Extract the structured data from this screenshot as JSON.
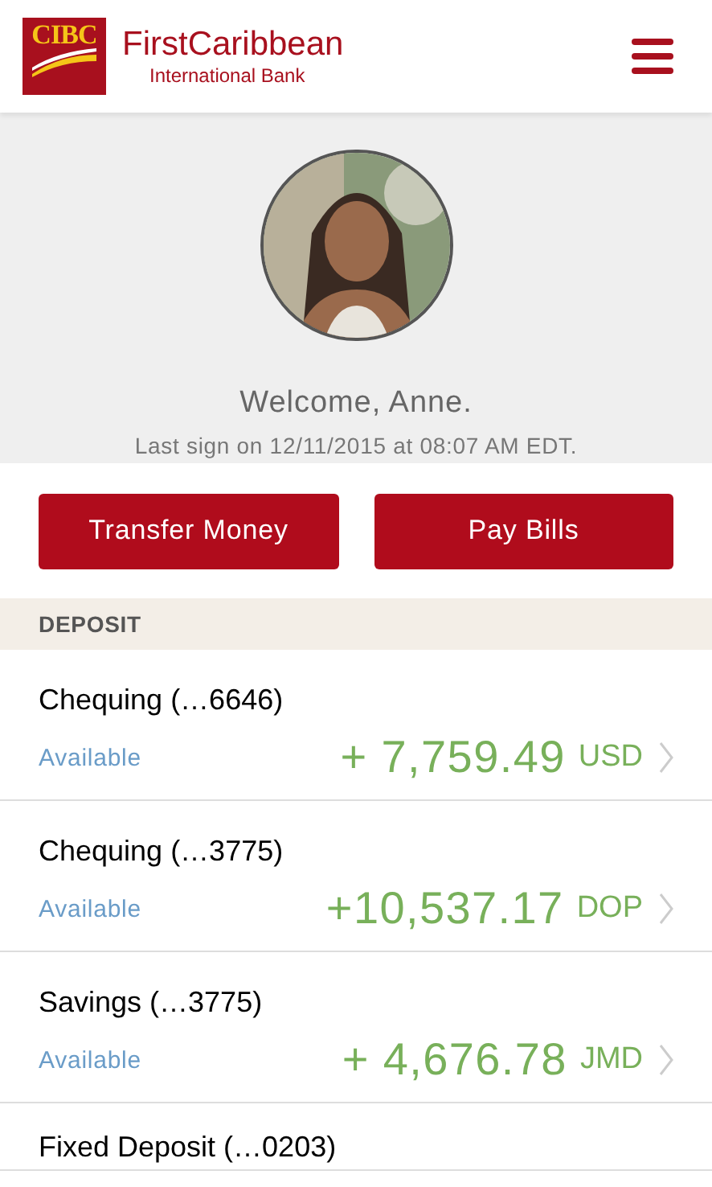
{
  "header": {
    "logo_mark": "CIBC",
    "brand": "FirstCaribbean",
    "brand_sub": "International Bank"
  },
  "profile": {
    "welcome": "Welcome, Anne.",
    "last_sign": "Last sign on 12/11/2015 at 08:07 AM EDT."
  },
  "actions": [
    "Transfer Money",
    "Pay Bills"
  ],
  "section": {
    "title": "DEPOSIT"
  },
  "accounts": [
    {
      "name": "Chequing (…6646)",
      "label": "Available",
      "amount": "+ 7,759.49",
      "currency": "USD"
    },
    {
      "name": "Chequing (…3775)",
      "label": "Available",
      "amount": "+10,537.17",
      "currency": "DOP"
    },
    {
      "name": "Savings (…3775)",
      "label": "Available",
      "amount": "+ 4,676.78",
      "currency": "JMD"
    },
    {
      "name": "Fixed Deposit (…0203)"
    }
  ]
}
